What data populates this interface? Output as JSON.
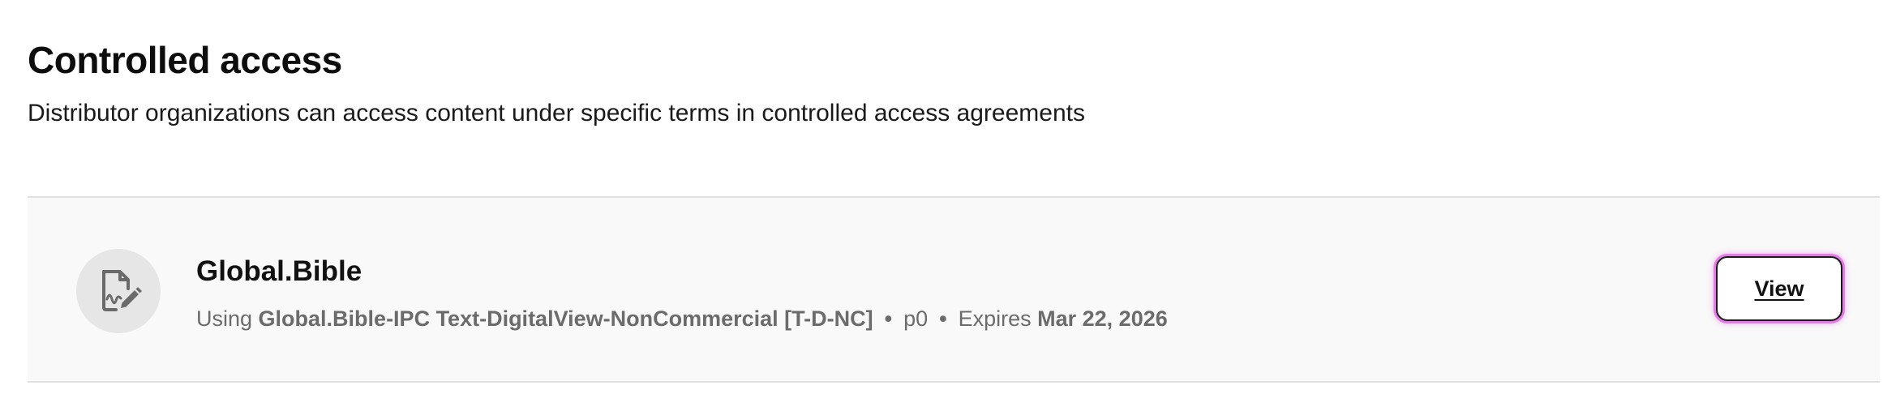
{
  "section": {
    "title": "Controlled access",
    "subtitle": "Distributor organizations can access content under specific terms in controlled access agreements"
  },
  "agreement": {
    "icon": "document-signature-icon",
    "name": "Global.Bible",
    "using_prefix": "Using",
    "license": "Global.Bible-IPC Text-DigitalView-NonCommercial [T-D-NC]",
    "separator": "•",
    "priority": "p0",
    "expires_prefix": "Expires",
    "expires_date": "Mar 22, 2026",
    "view_label": "View"
  },
  "colors": {
    "card_background": "#f9f9f9",
    "focus_ring": "#e67be8",
    "muted_text": "#6b6b6b",
    "icon_circle": "#e6e6e6"
  }
}
